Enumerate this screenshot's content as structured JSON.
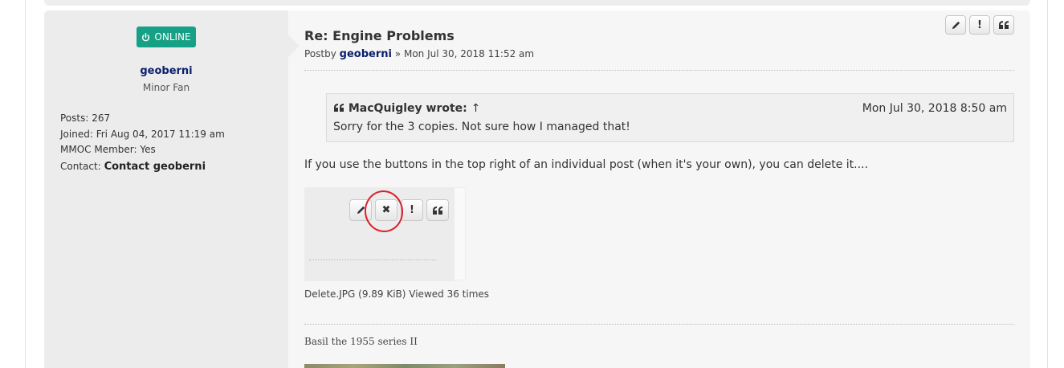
{
  "profile": {
    "status": "ONLINE",
    "username": "geoberni",
    "rank": "Minor Fan",
    "posts_label": "Posts:",
    "posts_value": "267",
    "joined_label": "Joined:",
    "joined_value": "Fri Aug 04, 2017 11:19 am",
    "member_label": "MMOC Member:",
    "member_value": "Yes",
    "contact_label": "Contact:",
    "contact_value": "Contact geoberni"
  },
  "post": {
    "title": "Re: Engine Problems",
    "by_prefix": "Postby",
    "author": "geoberni",
    "date_sep": "»",
    "date": "Mon Jul 30, 2018 11:52 am",
    "buttons": {
      "edit_icon": "pencil-icon",
      "report_icon": "exclamation-icon",
      "quote_icon": "quote-icon"
    },
    "quote": {
      "author": "MacQuigley wrote:",
      "arrow": "↑",
      "date": "Mon Jul 30, 2018 8:50 am",
      "text": "Sorry for the 3 copies. Not sure how I managed that!"
    },
    "body": "If you use the buttons in the top right of an individual post (when it's your own), you can delete it....",
    "attachment": {
      "caption": "Delete.JPG (9.89 KiB) Viewed 36 times"
    },
    "signature": "Basil the 1955 series II"
  },
  "colors": {
    "online_badge": "#16a085",
    "username": "#0a1f6b",
    "annotation_circle": "#d9232b"
  }
}
